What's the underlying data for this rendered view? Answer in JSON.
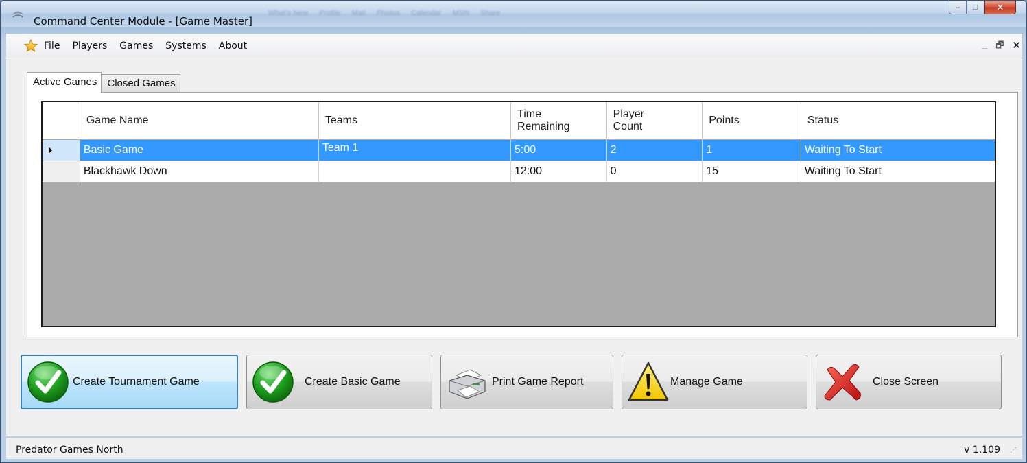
{
  "window": {
    "title": "Command Center Module - [Game Master]",
    "background_tabs": [
      "What's New",
      "Profile",
      "Mail",
      "Photos",
      "Calendar",
      "MSN",
      "Share"
    ],
    "caption": {
      "minimize": "‒",
      "maximize": "□",
      "close": "✕"
    }
  },
  "menu": {
    "items": [
      "File",
      "Players",
      "Games",
      "Systems",
      "About"
    ],
    "mdi": {
      "minimize": "_",
      "restore": "🗗",
      "close": "✕"
    }
  },
  "tabs": [
    {
      "label": "Active Games",
      "active": true
    },
    {
      "label": "Closed Games",
      "active": false
    }
  ],
  "grid": {
    "columns": [
      "",
      "Game Name",
      "Teams",
      "Time\nRemaining",
      "Player\nCount",
      "Points",
      "Status"
    ],
    "rows": [
      {
        "game_name": "Basic Game",
        "teams": "Team 1",
        "time_remaining": "5:00",
        "player_count": "2",
        "points": "1",
        "status": "Waiting To Start",
        "selected": true
      },
      {
        "game_name": "Blackhawk Down",
        "teams": "",
        "time_remaining": "12:00",
        "player_count": "0",
        "points": "15",
        "status": "Waiting To Start",
        "selected": false
      }
    ]
  },
  "buttons": {
    "create_tournament": "Create Tournament  Game",
    "create_basic": "Create Basic  Game",
    "print_report": "Print Game Report",
    "manage_game": "Manage Game",
    "close_screen": "Close Screen"
  },
  "status": {
    "left": "Predator Games North",
    "right": "v 1.109"
  },
  "colors": {
    "selection": "#3399ff",
    "grid_background": "#ababab",
    "check_green": "#1e9e1e",
    "warning_yellow": "#f6d300",
    "close_red": "#d62020"
  }
}
